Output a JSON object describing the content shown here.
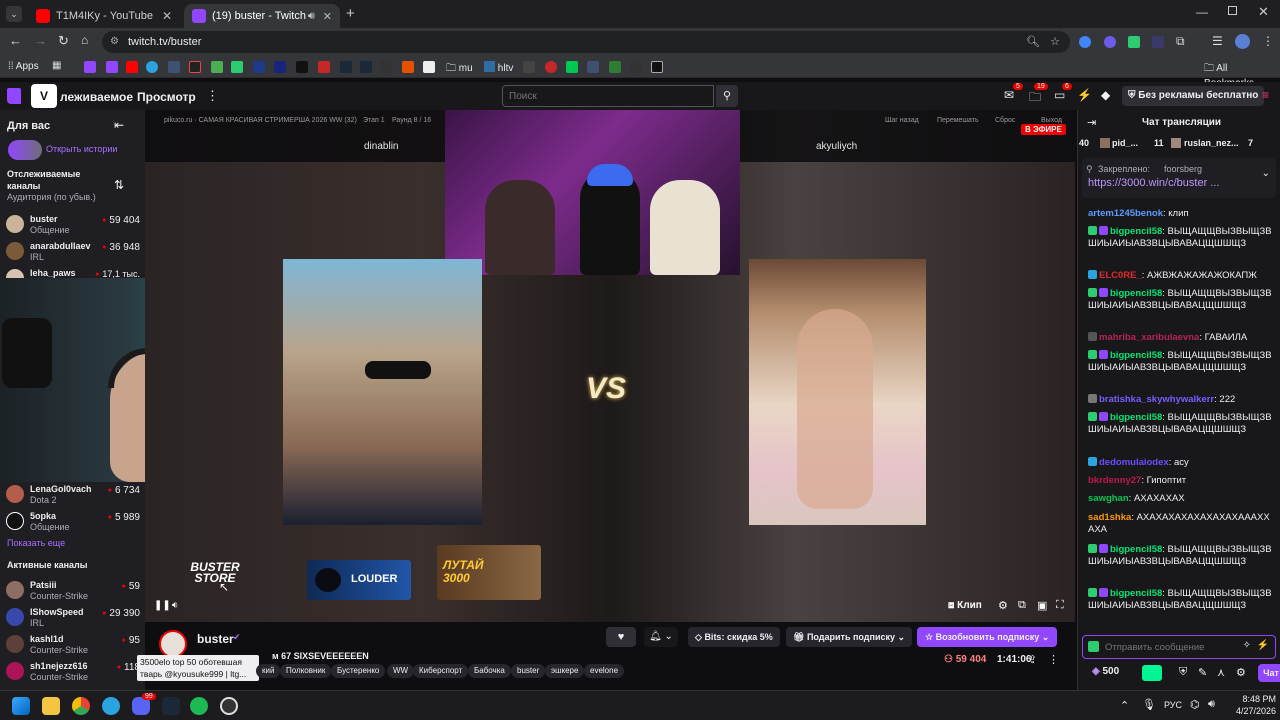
{
  "browser": {
    "tabs": [
      {
        "title": "T1M4IKу - YouTube"
      },
      {
        "title": "(19) buster - Twitch"
      }
    ],
    "url": "twitch.tv/buster",
    "bookmarks": {
      "apps": "Apps",
      "mu": "mu",
      "hltv": "hltv",
      "all": "All Bookmarks"
    }
  },
  "twitch": {
    "nav_following": "Отслеживаемое",
    "nav_following_visible": "леживаемое",
    "nav_browse": "Просмотр",
    "search_placeholder": "Поиск",
    "badges": {
      "notif": "5",
      "inbox": "19",
      "whispers": "6"
    },
    "no_ads": "Без рекламы бесплатно"
  },
  "sidebar": {
    "for_you": "Для вас",
    "open_stories": "Открыть истории",
    "followed_title": "Отслеживаемые каналы",
    "sort": "Аудитория (по убыв.)",
    "followed": [
      {
        "name": "buster",
        "cat": "Общение",
        "viewers": "59 404"
      },
      {
        "name": "anarabdullaev",
        "cat": "IRL",
        "viewers": "36 948"
      },
      {
        "name": "leha_paws",
        "cat": "",
        "viewers": "17,1 тыс."
      },
      {
        "name": "LenaGol0vach",
        "cat": "Dota 2",
        "viewers": "6 734"
      },
      {
        "name": "5opka",
        "cat": "Общение",
        "viewers": "5 989"
      }
    ],
    "show_more": "Показать еще",
    "active_title": "Активные каналы",
    "active": [
      {
        "name": "Patsiii",
        "cat": "Counter-Strike",
        "viewers": "59"
      },
      {
        "name": "IShowSpeed",
        "cat": "IRL",
        "viewers": "29 390"
      },
      {
        "name": "kashl1d",
        "cat": "Counter-Strike",
        "viewers": "95"
      },
      {
        "name": "sh1nejezz616",
        "cat": "Counter-Strike",
        "viewers": "118"
      }
    ]
  },
  "video": {
    "site": "pikuco.ru · САМАЯ КРАСИВАЯ СТРИМЕРША 2026 WW (32)",
    "stage": "Этап 1",
    "round": "Раунд 8 / 16",
    "ctrl_back": "Шаг назад",
    "ctrl_shuffle": "Перемешать",
    "ctrl_reset": "Сброс",
    "ctrl_exit": "Выход",
    "live": "В ЭФИРЕ",
    "left_name": "dinablin",
    "right_name": "akyuliych",
    "vs": "VS",
    "store": "BUSTER STORE",
    "louder": "LOUDER",
    "lutay": "ЛУТАЙ 3000",
    "clip": "Клип"
  },
  "stream": {
    "streamer": "buster",
    "title_tail": "м 67 SIXSEVEEEEEEN",
    "tooltip": "3500elo top 50 оботевшая тварь @kyousuke999 | ltg...",
    "tags": [
      "кий",
      "Полковник",
      "Бустеренко",
      "WW",
      "Киберспорт",
      "Бабочка",
      "buster",
      "эшкере",
      "evelone"
    ],
    "bits": "Bits: скидка 5%",
    "subscribe": "Подарить подписку",
    "resub": "Возобновить подписку",
    "viewers": "59 404",
    "uptime": "1:41:06"
  },
  "chat": {
    "title": "Чат трансляции",
    "top": {
      "count_left": "40",
      "user1": "pid_...",
      "count1": "11",
      "user2": "ruslan_nez...",
      "count2": "7"
    },
    "pinned_label": "Закреплено:",
    "pinned_user": "foorsberg",
    "pinned_link": "https://3000.win/c/buster ...",
    "messages": [
      {
        "user": "artem1245benok",
        "color": "#5b9bff",
        "text": "клип"
      },
      {
        "user": "bigpencil58",
        "color": "#00e676",
        "text": "ВЫЩАЩЩВЫЗВЫЩЗВШИЫАИЫАВЗВЦЫВАВАЦЩШШЩЗ"
      },
      {
        "user": "ELC0RE_",
        "color": "#e0292d",
        "text": "АЖВЖАЖАЖАЖОКАПЖ"
      },
      {
        "user": "bigpencil58",
        "color": "#00e676",
        "text": "ВЫЩАЩЩВЫЗВЫЩЗВШИЫАИЫАВЗВЦЫВАВАЦЩШШЩЗ"
      },
      {
        "user": "mahriba_xaribulaevna",
        "color": "#b4235a",
        "text": "ГАВАИЛА"
      },
      {
        "user": "bigpencil58",
        "color": "#00e676",
        "text": "ВЫЩАЩЩВЫЗВЫЩЗВШИЫАИЫАВЗВЦЫВАВАЦЩШШЩЗ"
      },
      {
        "user": "bratishka_skywhywalkerr",
        "color": "#7a5cff",
        "text": "222"
      },
      {
        "user": "bigpencil58",
        "color": "#00e676",
        "text": "ВЫЩАЩЩВЫЗВЫЩЗВШИЫАИЫАВЗВЦЫВАВАЦЩШШЩЗ"
      },
      {
        "user": "dedomulaiodex",
        "color": "#6d4cff",
        "text": "асу"
      },
      {
        "user": "bkrdenny27",
        "color": "#c0174b",
        "text": "Гипоптит"
      },
      {
        "user": "sawghan",
        "color": "#00c853",
        "text": "АХАХАХАХ"
      },
      {
        "user": "sad1shka",
        "color": "#ff9800",
        "text": "АХАХАХАХАХАХАХАХАААХХАХА"
      },
      {
        "user": "bigpencil58",
        "color": "#00e676",
        "text": "ВЫЩАЩЩВЫЗВЫЩЗВШИЫАИЫАВЗВЦЫВАВАЦЩШШЩЗ"
      },
      {
        "user": "bigpencil58",
        "color": "#00e676",
        "text": "ВЫЩАЩЩВЫЗВЫЩЗВШИЫАИЫАВЗВЦЫВАВАЦЩШШЩЗ"
      }
    ],
    "input_placeholder": "Отправить сообщение",
    "points": "500",
    "send": "Чат"
  },
  "taskbar": {
    "lang": "РУС",
    "time": "8:48 PM",
    "date": "4/27/2026",
    "discord_badge": "99"
  },
  "colors": {
    "twitch_purple": "#9147ff",
    "live_red": "#eb0400",
    "bg": "#0e0e10"
  }
}
